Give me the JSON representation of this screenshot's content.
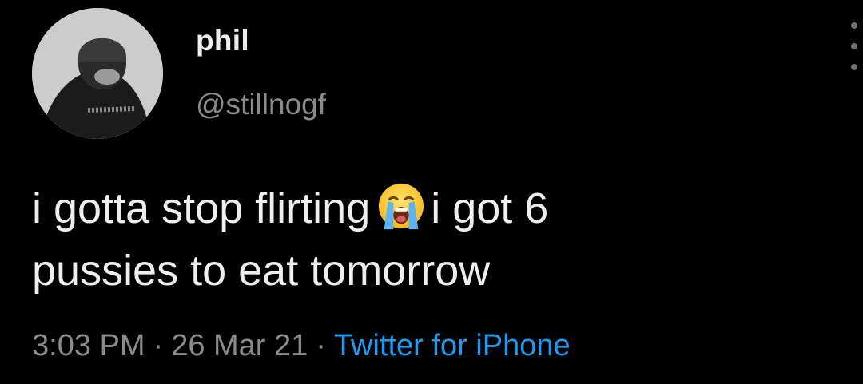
{
  "tweet": {
    "author": {
      "display_name": "phil",
      "handle": "@stillnogf",
      "avatar_icon": "profile-photo-avatar"
    },
    "text": {
      "line1_before_emoji": "i gotta stop flirting",
      "emoji_icon": "loudly-crying-face-emoji",
      "line1_after_emoji": "i got 6",
      "line2": "pussies to eat tomorrow"
    },
    "meta": {
      "time": "3:03 PM",
      "separator": "·",
      "date": "26 Mar 21",
      "source": "Twitter for iPhone"
    },
    "more_icon": "more-options-icon"
  },
  "colors": {
    "background": "#000000",
    "primary_text": "#eeeeee",
    "secondary_text": "#8b8b8b",
    "link": "#1d9bf0"
  }
}
